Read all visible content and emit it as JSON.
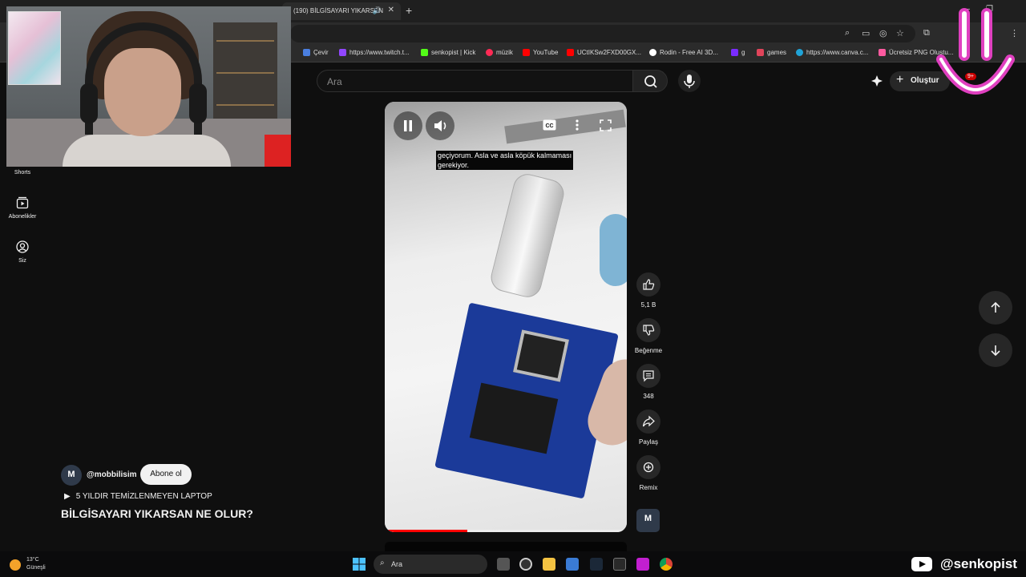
{
  "browser": {
    "tab_title": "(190) BİLGİSAYARI YIKARSAN",
    "bookmarks": [
      {
        "label": "Çevir",
        "color": "#4a7fe0"
      },
      {
        "label": "https://www.twitch.t...",
        "color": "#9146ff"
      },
      {
        "label": "senkopist | Kick",
        "color": "#53fc18"
      },
      {
        "label": "müzik",
        "color": "#ff2a55"
      },
      {
        "label": "YouTube",
        "color": "#ff0000"
      },
      {
        "label": "UCtIKSw2FXD00GX...",
        "color": "#ff0000"
      },
      {
        "label": "Rodin - Free AI 3D...",
        "color": "#ffffff"
      },
      {
        "label": "g",
        "color": "#7a2cff"
      },
      {
        "label": "games",
        "color": "#e0445a"
      },
      {
        "label": "https://www.canva.c...",
        "color": "#20a4d8"
      },
      {
        "label": "Ücretsiz PNG Oluştu...",
        "color": "#ff5aa0"
      }
    ]
  },
  "header": {
    "search_placeholder": "Ara",
    "create_label": "Oluştur",
    "notification_count": "9+"
  },
  "sidebar": {
    "items": [
      {
        "label": "Shorts"
      },
      {
        "label": "Abonelikler"
      },
      {
        "label": "Siz"
      }
    ]
  },
  "player": {
    "caption_line1": "geçiyorum. Asla ve asla köpük kalmaması",
    "caption_line2": "gerekiyor.",
    "cc_label": "CC",
    "progress": 0.34
  },
  "actions": {
    "like_count": "5,1 B",
    "dislike_label": "Beğenme",
    "comment_count": "348",
    "share_label": "Paylaş",
    "remix_label": "Remix"
  },
  "overlay": {
    "channel_initial": "M",
    "channel_name": "@mobbilisim",
    "subscribe_label": "Abone ol",
    "playlist_label": "5 YILDIR TEMİZLENMEYEN LAPTOP",
    "video_title": "BİLGİSAYARI YIKARSAN NE OLUR?"
  },
  "taskbar": {
    "temperature": "13°C",
    "weather_condition": "Güneşli",
    "search_placeholder": "Ara"
  },
  "branding": {
    "handle": "@senkopist"
  },
  "colors": {
    "background": "#0f0f0f",
    "accent_red": "#ff0000",
    "smile_pink": "#e040c0"
  }
}
